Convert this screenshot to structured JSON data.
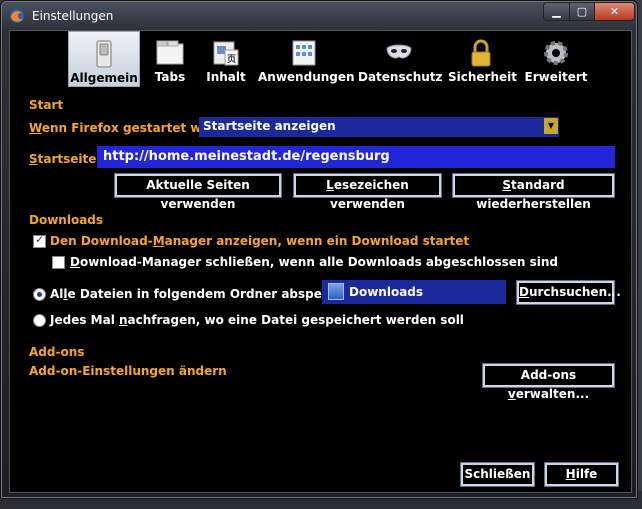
{
  "window": {
    "title": "Einstellungen",
    "min_glyph": "▁",
    "max_glyph": "▢",
    "close_glyph": "✕"
  },
  "background": {
    "text": ""
  },
  "toolbar": {
    "items": [
      {
        "label": "Allgemein",
        "icon": "switch-icon",
        "selected": true
      },
      {
        "label": "Tabs",
        "icon": "tabs-icon"
      },
      {
        "label": "Inhalt",
        "icon": "content-icon"
      },
      {
        "label": "Anwendungen",
        "icon": "applications-icon"
      },
      {
        "label": "Datenschutz",
        "icon": "mask-icon"
      },
      {
        "label": "Sicherheit",
        "icon": "lock-icon"
      },
      {
        "label": "Erweitert",
        "icon": "gear-icon"
      }
    ]
  },
  "start": {
    "heading": "Start",
    "startup_label_u": "W",
    "startup_label_rest": "enn Firefox gestartet wird:",
    "startup_value": "Startseite anzeigen",
    "homepage_label_u": "S",
    "homepage_label_rest": "tartseite:",
    "homepage_value": "http://home.meinestadt.de/regensburg",
    "btn_current": "Aktuelle Seiten verwenden",
    "btn_bookmark_u": "L",
    "btn_bookmark_rest": "esezeichen verwenden",
    "btn_default_u": "S",
    "btn_default_rest": "tandard wiederherstellen"
  },
  "downloads": {
    "heading": "Downloads",
    "show_manager_pre": "Den Download-",
    "show_manager_u": "M",
    "show_manager_post": "anager anzeigen, wenn ein Download startet",
    "show_manager_checked": true,
    "close_manager_pre": "D",
    "close_manager_post": "ownload-Manager schließen, wenn alle Downloads abgeschlossen sind",
    "close_manager_checked": false,
    "save_to_pre": "Al",
    "save_to_u": "l",
    "save_to_post": "e Dateien in folgendem Ordner abspeichern:",
    "save_to_selected": true,
    "folder": "Downloads",
    "browse_u": "D",
    "browse_rest": "urchsuchen...",
    "ask_pre": "Jedes Mal ",
    "ask_u": "n",
    "ask_post": "achfragen, wo eine Datei gespeichert werden soll",
    "ask_selected": false
  },
  "addons": {
    "heading": "Add-ons",
    "desc": "Add-on-Einstellungen ändern",
    "btn_pre": "Add-ons ",
    "btn_u": "v",
    "btn_post": "erwalten..."
  },
  "footer": {
    "close": "Schließen",
    "help_u": "H",
    "help_rest": "ilfe"
  },
  "colors": {
    "accent": "#f5a623",
    "field": "#2226d8",
    "select": "#1a2a9c"
  }
}
